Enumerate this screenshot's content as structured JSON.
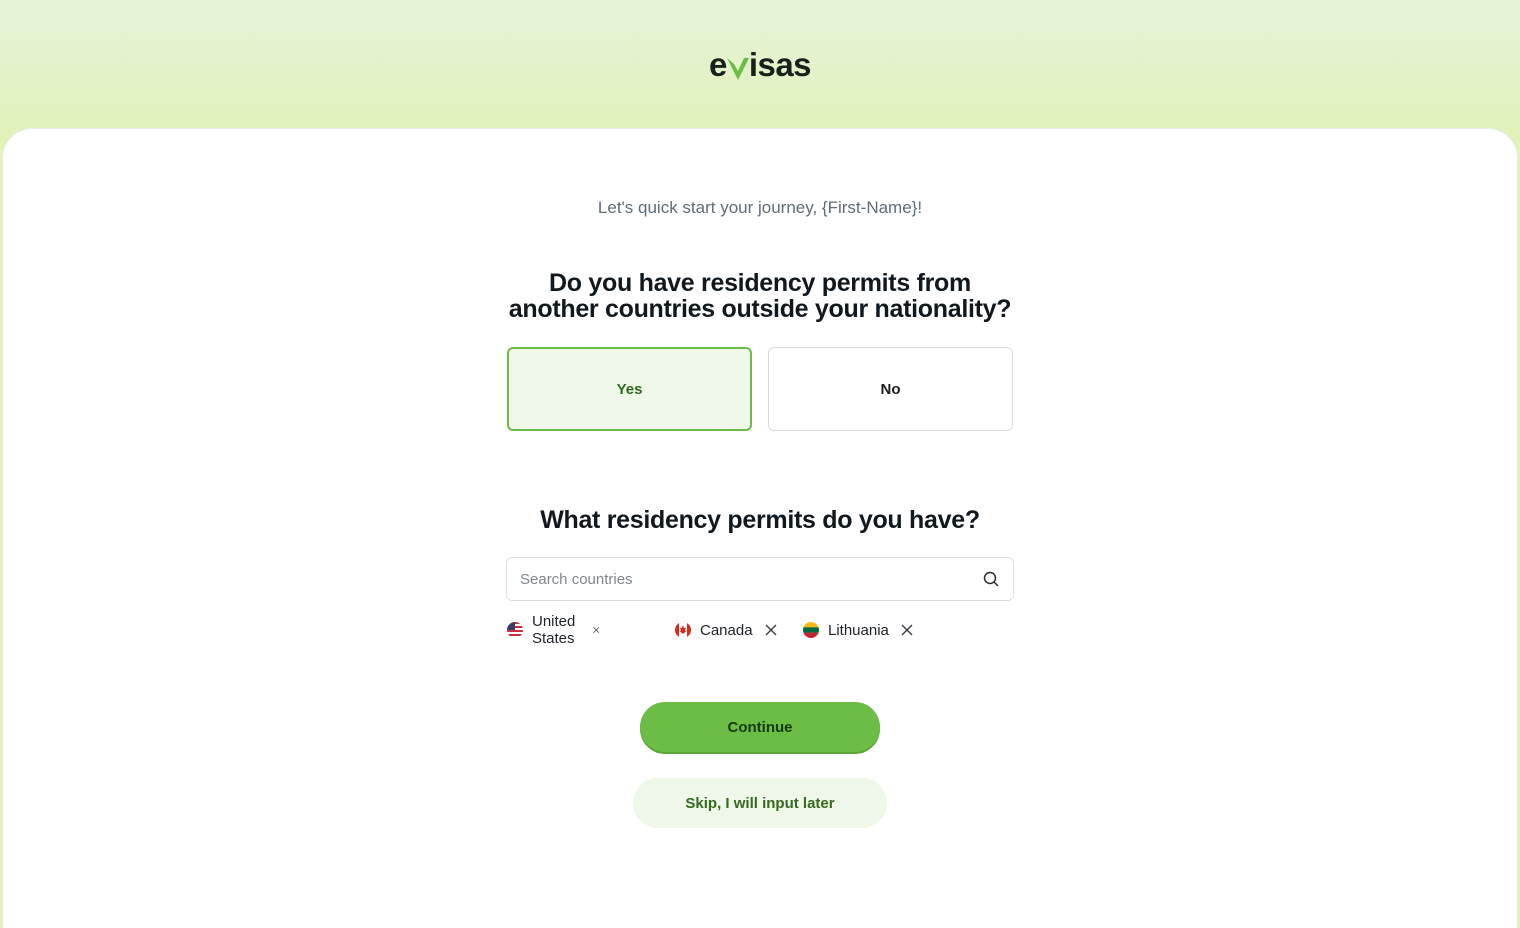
{
  "brand": {
    "logo_prefix": "e",
    "logo_suffix": "isas",
    "accent_color": "#6cbd45"
  },
  "greeting": "Let's quick start your journey, {First-Name}!",
  "question1": {
    "line1": "Do you have residency permits from",
    "line2": "another countries outside your nationality?",
    "options": [
      {
        "label": "Yes",
        "selected": true
      },
      {
        "label": "No",
        "selected": false
      }
    ]
  },
  "question2": {
    "title": "What residency permits do you have?",
    "search_placeholder": "Search countries",
    "search_value": "",
    "search_icon": "search-icon",
    "selected_countries": [
      {
        "name": "United States",
        "flag": "us-flag-icon"
      },
      {
        "name": "Canada",
        "flag": "canada-flag-icon"
      },
      {
        "name": "Lithuania",
        "flag": "lithuania-flag-icon"
      }
    ]
  },
  "actions": {
    "continue_label": "Continue",
    "skip_label": "Skip, I will input later"
  }
}
